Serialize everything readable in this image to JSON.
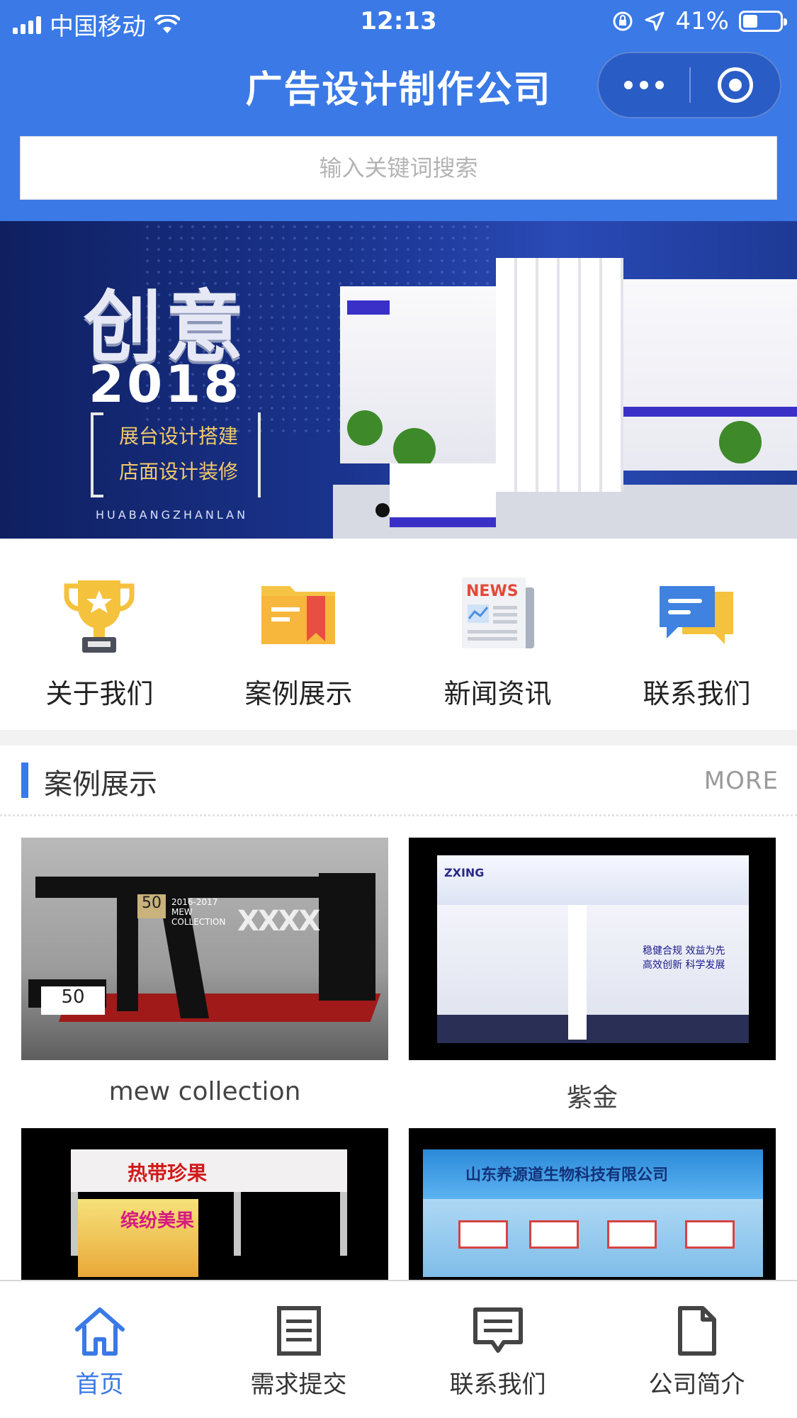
{
  "status_bar": {
    "carrier": "中国移动",
    "time": "12:13",
    "battery": "41%",
    "battery_level": 0.41
  },
  "nav": {
    "title": "广告设计制作公司",
    "menu_icon": "more-dots-icon",
    "close_icon": "target-circle-icon"
  },
  "search": {
    "placeholder": "输入关键词搜索",
    "value": ""
  },
  "banner": {
    "headline": "创意",
    "year": "2018",
    "line1": "展台设计搭建",
    "line2": "店面设计装修",
    "sub": "HUABANGZHANLAN",
    "slides": 2,
    "active_slide": 1
  },
  "quick_nav": [
    {
      "label": "关于我们",
      "icon": "trophy-icon"
    },
    {
      "label": "案例展示",
      "icon": "folder-icon"
    },
    {
      "label": "新闻资讯",
      "icon": "newspaper-icon"
    },
    {
      "label": "联系我们",
      "icon": "chat-bubble-icon"
    }
  ],
  "cases_section": {
    "title": "案例展示",
    "more": "MORE",
    "items": [
      {
        "caption": "mew collection"
      },
      {
        "caption": "紫金"
      },
      {
        "caption": ""
      },
      {
        "caption": ""
      }
    ]
  },
  "tabbar": [
    {
      "label": "首页",
      "icon": "home-icon",
      "active": true
    },
    {
      "label": "需求提交",
      "icon": "list-doc-icon",
      "active": false
    },
    {
      "label": "联系我们",
      "icon": "message-icon",
      "active": false
    },
    {
      "label": "公司简介",
      "icon": "file-icon",
      "active": false
    }
  ],
  "colors": {
    "primary": "#3a79e6",
    "tab_active": "#3a79e6",
    "text": "#333333",
    "more": "#9a9a9a"
  }
}
